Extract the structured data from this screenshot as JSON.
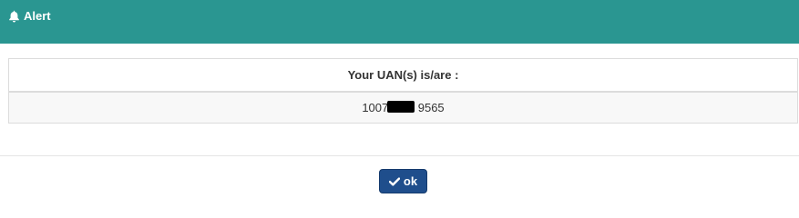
{
  "dialog": {
    "title": "Alert",
    "title_icon": "bell-icon",
    "header_color": "#2a9691"
  },
  "uan_table": {
    "header": "Your UAN(s) is/are :",
    "rows": [
      {
        "uan": "1007         9565",
        "redacted": true
      }
    ]
  },
  "actions": {
    "ok_label": "ok",
    "ok_icon": "check-icon",
    "ok_color": "#1f4e8c"
  }
}
